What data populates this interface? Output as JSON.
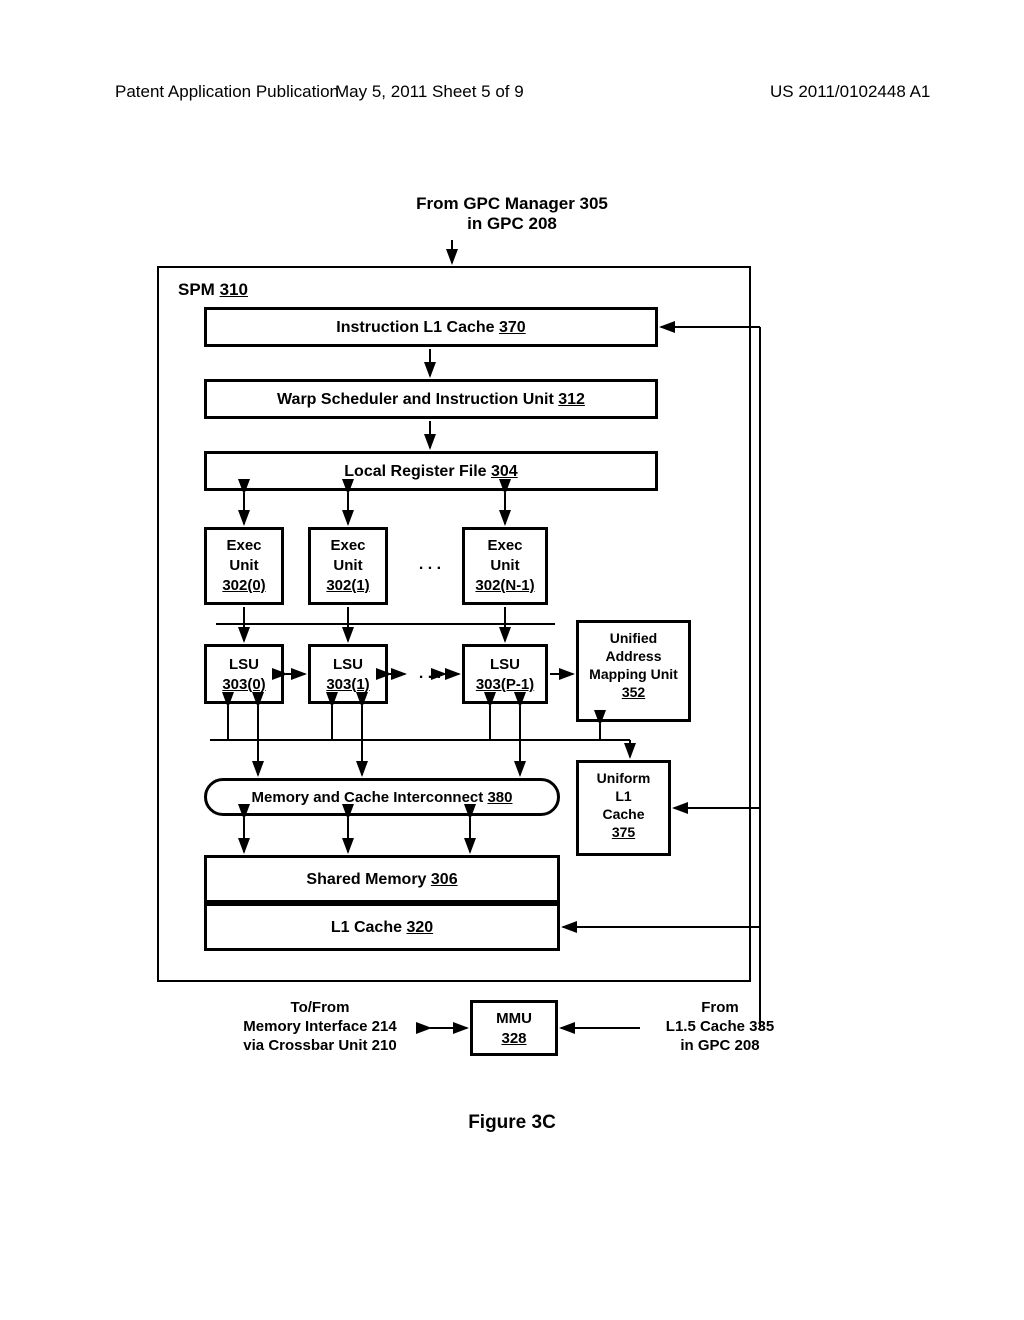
{
  "header": {
    "left": "Patent Application Publication",
    "mid": "May 5, 2011  Sheet 5 of 9",
    "right": "US 2011/0102448 A1"
  },
  "top_label_l1": "From GPC Manager 305",
  "top_label_l2": "in GPC 208",
  "spm_label": "SPM ",
  "spm_num": "310",
  "il1_text": "Instruction L1 Cache ",
  "il1_num": "370",
  "warp_text": "Warp Scheduler and Instruction Unit ",
  "warp_num": "312",
  "lrf_text": "Local Register File ",
  "lrf_num": "304",
  "exec_l1": "Exec",
  "exec_l2": "Unit",
  "exec0": "302(0)",
  "exec1": "302(1)",
  "execN": "302(N-1)",
  "dots": ". . .",
  "lsu": "LSU",
  "lsu0": "303(0)",
  "lsu1": "303(1)",
  "lsuP": "303(P-1)",
  "uamu_l1": "Unified",
  "uamu_l2": "Address",
  "uamu_l3": "Mapping Unit",
  "uamu_num": "352",
  "mci_text": "Memory and Cache Interconnect ",
  "mci_num": "380",
  "ul1_l1": "Uniform",
  "ul1_l2": "L1",
  "ul1_l3": "Cache",
  "ul1_num": "375",
  "shmem_text": "Shared Memory ",
  "shmem_num": "306",
  "l1c_text": "L1 Cache ",
  "l1c_num": "320",
  "bot_left_l1": "To/From",
  "bot_left_l2": "Memory Interface 214",
  "bot_left_l3": "via Crossbar Unit 210",
  "mmu_l1": "MMU",
  "mmu_num": "328",
  "bot_right_l1": "From",
  "bot_right_l2": "L1.5 Cache 335",
  "bot_right_l3": "in GPC 208",
  "figure": "Figure 3C"
}
